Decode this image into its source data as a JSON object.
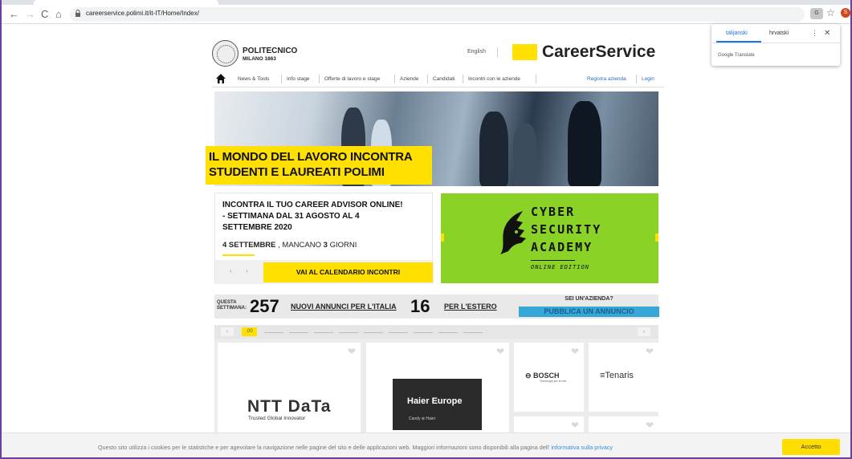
{
  "browser": {
    "url": "careerservice.polimi.it/it-IT/Home/Index/",
    "back": "←",
    "forward": "→",
    "reload": "C",
    "home": "⌂",
    "star": "☆",
    "profile_initial": "S"
  },
  "translate_popup": {
    "lang_active": "talijanski",
    "lang_other": "hrvatski",
    "more": "⋮",
    "close": "✕",
    "footer": "Google Translate"
  },
  "header": {
    "logo_name": "POLITECNICO",
    "logo_sub": "MILANO 1863",
    "lang_switch": "English",
    "site_title": "CareerService"
  },
  "menu": {
    "items": [
      "News & Tools",
      "Info stage",
      "Offerte di lavoro e stage",
      "Aziende",
      "Candidati",
      "Incontri con le aziende"
    ],
    "right": [
      "Registra azienda",
      "Login"
    ]
  },
  "hero": {
    "line1": "IL MONDO DEL LAVORO INCONTRA",
    "line2": "STUDENTI E LAUREATI POLIMI"
  },
  "event": {
    "title_lines": [
      "INCONTRA IL TUO CAREER ADVISOR ONLINE!",
      "- SETTIMANA DAL 31 AGOSTO AL 4",
      "SETTEMBRE 2020"
    ],
    "date_bold": "4 SETTEMBRE",
    "date_rest": " , MANCANO ",
    "days": "3",
    "days_word": " GIORNI",
    "prev": "‹",
    "next": "›",
    "calendar_button": "VAI AL CALENDARIO INCONTRI"
  },
  "banner": {
    "lines": [
      "CYBER",
      "SECURITY",
      "ACADEMY"
    ],
    "subtitle": "ONLINE EDITION"
  },
  "stats": {
    "week_label_1": "QUESTA",
    "week_label_2": "SETTIMANA:",
    "italy_count": "257",
    "italy_label": "NUOVI ANNUNCI PER L'ITALIA",
    "abroad_count": "16",
    "abroad_label": "PER L'ESTERO",
    "company_question": "SEI UN'AZIENDA?",
    "publish_button": "PUBBLICA UN ANNUNCIO"
  },
  "carousel": {
    "prev": "‹",
    "next": "›",
    "active_label": ".00"
  },
  "companies": {
    "ntt_name": "NTT DaTa",
    "ntt_tagline": "Trusted Global Innovator",
    "haier_name": "Haier Europe",
    "haier_brands": "Candy   ⊕   Haier",
    "bosch_name": "BOSCH",
    "bosch_tagline": "Tecnologia per la vita",
    "tenaris_name": "Tenaris"
  },
  "cookie": {
    "text": "Questo sito utilizza i cookies per le statistiche e per agevolare la navigazione nelle pagine del sito e delle applicazioni web. Maggiori informazioni sono disponibili alla pagina dell' ",
    "link": "informativa sulla privacy",
    "accept": "Accetto"
  },
  "colors": {
    "accent_yellow": "#ffe000",
    "banner_green": "#8ad326",
    "publish_blue": "#36a8d8",
    "link_blue": "#2a6ebb"
  }
}
